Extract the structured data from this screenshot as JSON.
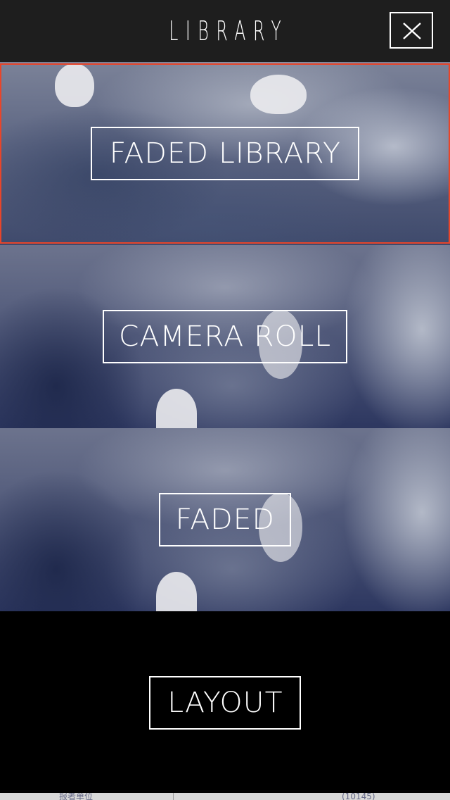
{
  "header": {
    "title": "LIBRARY",
    "close_icon": "close-icon"
  },
  "rows": [
    {
      "label": "FADED LIBRARY",
      "selected": true
    },
    {
      "label": "CAMERA ROLL",
      "selected": false
    },
    {
      "label": "FADED",
      "selected": false
    },
    {
      "label": "LAYOUT",
      "selected": false
    }
  ],
  "bottom_strip": {
    "left_text": "报者单位",
    "right_text": "(10145)"
  },
  "colors": {
    "header_bg": "#1e1e1e",
    "selection_border": "#e8452a",
    "text": "#ffffff"
  }
}
